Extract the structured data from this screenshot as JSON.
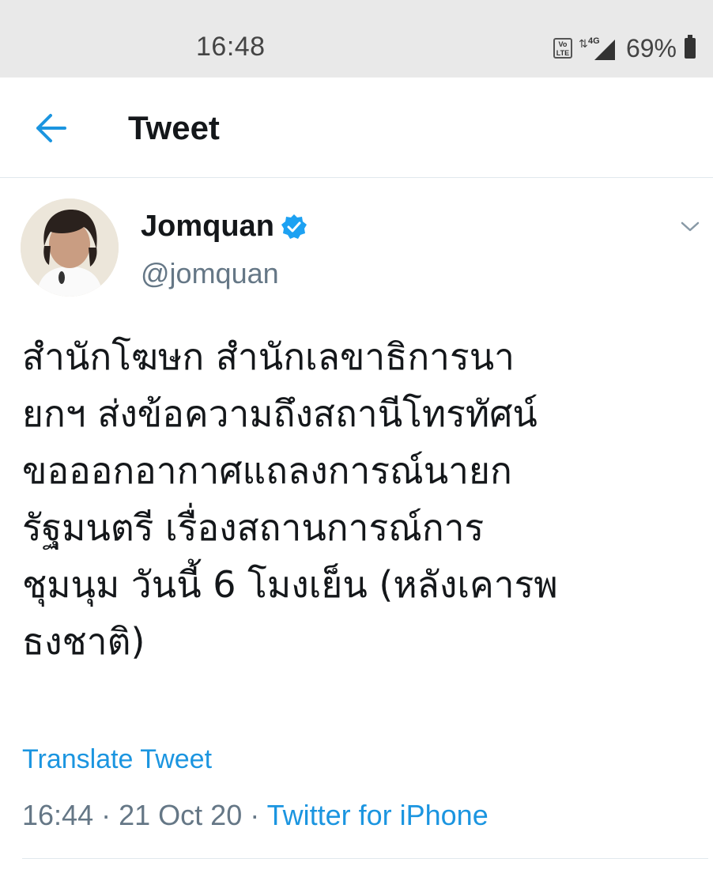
{
  "status_bar": {
    "time": "16:48",
    "volte_label": "Vo LTE",
    "network_type": "4G",
    "battery_percent": "69%"
  },
  "header": {
    "title": "Tweet"
  },
  "tweet": {
    "author_name": "Jomquan",
    "handle": "@jomquan",
    "verified": true,
    "text": "สำนักโฆษก สำนักเลขาธิการนา\nยกฯ ส่งข้อความถึงสถานีโทรทัศน์\nขอออกอากาศแถลงการณ์นายก\nรัฐมนตรี  เรื่องสถานการณ์การ\nชุมนุม วันนี้ 6 โมงเย็น (หลังเคารพ\nธงชาติ)",
    "translate_label": "Translate Tweet",
    "time": "16:44",
    "date": "21 Oct 20",
    "separator": "·",
    "source": "Twitter for iPhone"
  },
  "colors": {
    "accent": "#1b95e0",
    "muted": "#657786",
    "text": "#14171a",
    "status_bar_bg": "#e9e9e9"
  },
  "icons": {
    "back": "arrow-left-icon",
    "verified": "verified-badge-icon",
    "menu": "chevron-down-icon",
    "signal": "signal-icon",
    "battery": "battery-icon"
  }
}
